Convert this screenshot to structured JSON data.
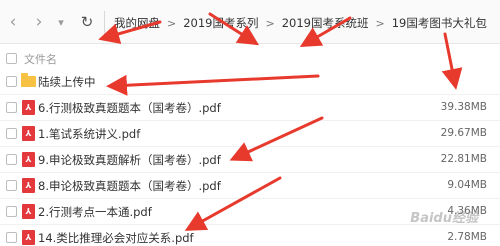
{
  "toolbar": {
    "back_icon": "‹",
    "forward_icon": "›",
    "dropdown_icon": "▾",
    "refresh_icon": "↻",
    "breadcrumb": [
      "我的网盘",
      "2019国考系列",
      "2019国考系统班",
      "19国考图书大礼包"
    ],
    "separator": ">"
  },
  "list": {
    "header_label": "文件名",
    "rows": [
      {
        "type": "folder",
        "name": "陆续上传中",
        "size": ""
      },
      {
        "type": "pdf",
        "name": "6.行测极致真题题本（国考卷）.pdf",
        "size": "39.38MB"
      },
      {
        "type": "pdf",
        "name": "1.笔试系统讲义.pdf",
        "size": "29.67MB"
      },
      {
        "type": "pdf",
        "name": "9.申论极致真题解析（国考卷）.pdf",
        "size": "22.81MB"
      },
      {
        "type": "pdf",
        "name": "8.申论极致真题题本（国考卷）.pdf",
        "size": "9.04MB"
      },
      {
        "type": "pdf",
        "name": "2.行测考点一本通.pdf",
        "size": "4.36MB"
      },
      {
        "type": "pdf",
        "name": "14.类比推理必会对应关系.pdf",
        "size": "2.78MB"
      }
    ]
  },
  "watermark": "Baidu经验",
  "colors": {
    "arrow": "#e8392d",
    "pdf": "#e4393c",
    "folder": "#f7c244"
  }
}
